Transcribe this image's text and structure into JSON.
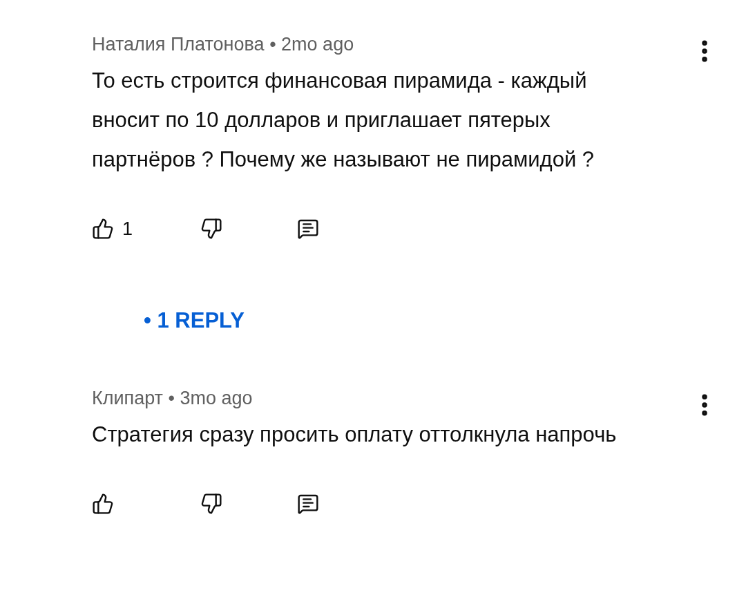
{
  "comments": [
    {
      "author": "Наталия Платонова",
      "separator": "•",
      "time": "2mo ago",
      "text": "То есть строится финансовая пирамида - каждый вносит по 10 долларов и приглашает пятерых партнёров ? Почему же называют не пирамидой ?",
      "likes": "1",
      "replies": "• 1 REPLY"
    },
    {
      "author": "Клипарт",
      "separator": "•",
      "time": "3mo ago",
      "text": "Стратегия сразу просить оплату оттолкнула напрочь"
    }
  ]
}
